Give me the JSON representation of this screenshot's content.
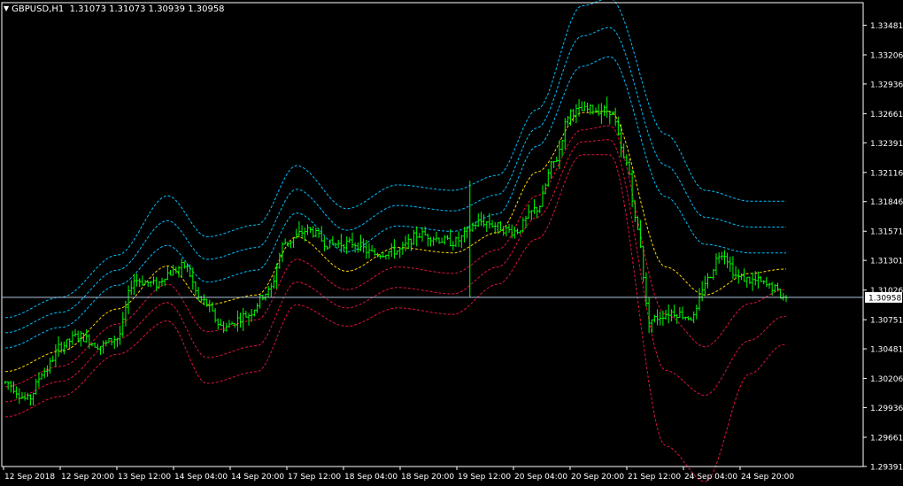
{
  "header": {
    "symbol": "GBPUSD,H1",
    "ohlc": "1.31073 1.31073 1.30939 1.30958"
  },
  "icons": {
    "collapse": "triangle-down-icon"
  },
  "colors": {
    "background": "#000000",
    "axis": "#ffffff",
    "candle": "#00ff00",
    "band_upper": "#00bfff",
    "band_middle": "#ffd700",
    "band_lower": "#dc143c",
    "current_price_line": "#b0c4de"
  },
  "chart_data": {
    "type": "line",
    "ylim": [
      1.2939,
      1.3369
    ],
    "y_ticks": [
      "1.33481",
      "1.33206",
      "1.32936",
      "1.32661",
      "1.32391",
      "1.32116",
      "1.31846",
      "1.31571",
      "1.31301",
      "1.31026",
      "1.30751",
      "1.30481",
      "1.30206",
      "1.29936",
      "1.29661",
      "1.29391"
    ],
    "x_ticks": [
      "12 Sep 2018",
      "12 Sep 20:00",
      "13 Sep 12:00",
      "14 Sep 04:00",
      "14 Sep 20:00",
      "17 Sep 12:00",
      "18 Sep 04:00",
      "18 Sep 20:00",
      "19 Sep 12:00",
      "20 Sep 04:00",
      "20 Sep 20:00",
      "21 Sep 12:00",
      "24 Sep 04:00",
      "24 Sep 20:00"
    ],
    "current_price": 1.30958,
    "current_price_label": "1.30958",
    "price_keyframes": [
      [
        0,
        1.3017
      ],
      [
        8,
        1.3001
      ],
      [
        14,
        1.3028
      ],
      [
        20,
        1.3051
      ],
      [
        26,
        1.306
      ],
      [
        34,
        1.3051
      ],
      [
        40,
        1.3058
      ],
      [
        46,
        1.3112
      ],
      [
        54,
        1.3108
      ],
      [
        58,
        1.3118
      ],
      [
        64,
        1.3125
      ],
      [
        70,
        1.3093
      ],
      [
        78,
        1.3068
      ],
      [
        86,
        1.3079
      ],
      [
        94,
        1.3101
      ],
      [
        100,
        1.3147
      ],
      [
        108,
        1.3158
      ],
      [
        116,
        1.3145
      ],
      [
        124,
        1.3146
      ],
      [
        132,
        1.3136
      ],
      [
        140,
        1.3139
      ],
      [
        148,
        1.3154
      ],
      [
        160,
        1.3147
      ],
      [
        170,
        1.3166
      ],
      [
        182,
        1.3157
      ],
      [
        190,
        1.3178
      ],
      [
        196,
        1.3221
      ],
      [
        202,
        1.3268
      ],
      [
        210,
        1.327
      ],
      [
        216,
        1.3269
      ],
      [
        222,
        1.322
      ],
      [
        226,
        1.3158
      ],
      [
        230,
        1.3075
      ],
      [
        238,
        1.3082
      ],
      [
        246,
        1.3077
      ],
      [
        250,
        1.311
      ],
      [
        256,
        1.3138
      ],
      [
        262,
        1.3114
      ],
      [
        268,
        1.3111
      ],
      [
        274,
        1.3105
      ],
      [
        278,
        1.3096
      ]
    ],
    "series": [
      {
        "role": "band-upper-3",
        "values": [
          [
            0,
            1.3077
          ],
          [
            20,
            1.3096
          ],
          [
            40,
            1.3135
          ],
          [
            58,
            1.319
          ],
          [
            72,
            1.3152
          ],
          [
            90,
            1.3163
          ],
          [
            104,
            1.3218
          ],
          [
            122,
            1.3178
          ],
          [
            140,
            1.32
          ],
          [
            160,
            1.3195
          ],
          [
            176,
            1.3209
          ],
          [
            190,
            1.327
          ],
          [
            206,
            1.3366
          ],
          [
            216,
            1.3373
          ],
          [
            236,
            1.3247
          ],
          [
            250,
            1.3195
          ],
          [
            266,
            1.3185
          ],
          [
            278,
            1.3185
          ]
        ]
      },
      {
        "role": "band-upper-2",
        "values": [
          [
            0,
            1.3063
          ],
          [
            20,
            1.3082
          ],
          [
            40,
            1.3121
          ],
          [
            58,
            1.3167
          ],
          [
            72,
            1.3131
          ],
          [
            90,
            1.3142
          ],
          [
            104,
            1.3196
          ],
          [
            122,
            1.3158
          ],
          [
            140,
            1.3181
          ],
          [
            160,
            1.3176
          ],
          [
            176,
            1.3191
          ],
          [
            190,
            1.3253
          ],
          [
            206,
            1.3338
          ],
          [
            216,
            1.3346
          ],
          [
            236,
            1.3218
          ],
          [
            250,
            1.317
          ],
          [
            266,
            1.3161
          ],
          [
            278,
            1.3161
          ]
        ]
      },
      {
        "role": "band-upper-1",
        "values": [
          [
            0,
            1.3049
          ],
          [
            20,
            1.3068
          ],
          [
            40,
            1.3107
          ],
          [
            58,
            1.3144
          ],
          [
            72,
            1.311
          ],
          [
            90,
            1.3121
          ],
          [
            104,
            1.3174
          ],
          [
            122,
            1.3138
          ],
          [
            140,
            1.3162
          ],
          [
            160,
            1.3157
          ],
          [
            176,
            1.3173
          ],
          [
            190,
            1.3236
          ],
          [
            206,
            1.331
          ],
          [
            216,
            1.3319
          ],
          [
            236,
            1.3189
          ],
          [
            250,
            1.3145
          ],
          [
            266,
            1.3137
          ],
          [
            278,
            1.3137
          ]
        ]
      },
      {
        "role": "band-middle",
        "values": [
          [
            0,
            1.3027
          ],
          [
            20,
            1.3046
          ],
          [
            40,
            1.3085
          ],
          [
            58,
            1.3125
          ],
          [
            72,
            1.3089
          ],
          [
            90,
            1.3098
          ],
          [
            104,
            1.3152
          ],
          [
            122,
            1.312
          ],
          [
            140,
            1.3142
          ],
          [
            160,
            1.3137
          ],
          [
            176,
            1.3156
          ],
          [
            190,
            1.3212
          ],
          [
            206,
            1.3267
          ],
          [
            216,
            1.3268
          ],
          [
            236,
            1.3124
          ],
          [
            250,
            1.3098
          ],
          [
            266,
            1.3118
          ],
          [
            278,
            1.3122
          ]
        ]
      },
      {
        "role": "band-lower-1",
        "values": [
          [
            0,
            1.3013
          ],
          [
            20,
            1.3032
          ],
          [
            40,
            1.3071
          ],
          [
            58,
            1.3108
          ],
          [
            72,
            1.3064
          ],
          [
            90,
            1.3075
          ],
          [
            104,
            1.3131
          ],
          [
            122,
            1.3103
          ],
          [
            140,
            1.3124
          ],
          [
            160,
            1.3118
          ],
          [
            176,
            1.314
          ],
          [
            190,
            1.319
          ],
          [
            206,
            1.3251
          ],
          [
            216,
            1.3255
          ],
          [
            236,
            1.308
          ],
          [
            250,
            1.305
          ],
          [
            266,
            1.309
          ],
          [
            278,
            1.3103
          ]
        ]
      },
      {
        "role": "band-lower-2",
        "values": [
          [
            0,
            1.2999
          ],
          [
            20,
            1.3018
          ],
          [
            40,
            1.3057
          ],
          [
            58,
            1.3091
          ],
          [
            72,
            1.304
          ],
          [
            90,
            1.3051
          ],
          [
            104,
            1.311
          ],
          [
            122,
            1.3086
          ],
          [
            140,
            1.3105
          ],
          [
            160,
            1.3099
          ],
          [
            176,
            1.3124
          ],
          [
            190,
            1.317
          ],
          [
            206,
            1.324
          ],
          [
            216,
            1.3242
          ],
          [
            236,
            1.3028
          ],
          [
            250,
            1.3005
          ],
          [
            266,
            1.3056
          ],
          [
            278,
            1.3078
          ]
        ]
      },
      {
        "role": "band-lower-3",
        "values": [
          [
            0,
            1.2985
          ],
          [
            20,
            1.3004
          ],
          [
            40,
            1.3043
          ],
          [
            58,
            1.3074
          ],
          [
            72,
            1.3016
          ],
          [
            90,
            1.3027
          ],
          [
            104,
            1.3089
          ],
          [
            122,
            1.3069
          ],
          [
            140,
            1.3086
          ],
          [
            160,
            1.308
          ],
          [
            176,
            1.3108
          ],
          [
            190,
            1.315
          ],
          [
            206,
            1.3228
          ],
          [
            216,
            1.3228
          ],
          [
            236,
            1.2958
          ],
          [
            250,
            1.2925
          ],
          [
            266,
            1.3025
          ],
          [
            278,
            1.3052
          ]
        ]
      }
    ]
  }
}
